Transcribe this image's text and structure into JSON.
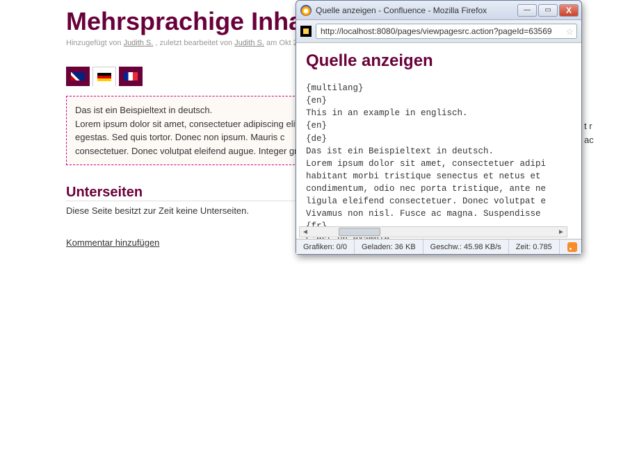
{
  "page": {
    "title": "Mehrsprachige Inha",
    "meta_prefix": "Hinzugefügt von ",
    "author": "Judith S.",
    "meta_mid": ", zuletzt bearbeitet von ",
    "editor": "Judith S.",
    "meta_date": " am Okt 20, 2",
    "content_line1": "Das ist ein Beispieltext in deutsch.",
    "content_line2": "Lorem ipsum dolor sit amet, consectetuer adipiscing elit,",
    "content_line3": "egestas. Sed quis tortor. Donec non ipsum. Mauris c",
    "content_line4": "consectetuer. Donec volutpat eleifend augue. Integer gravi",
    "subsection_title": "Unterseiten",
    "subsection_text": "Diese Seite besitzt zur Zeit keine Unterseiten.",
    "add_comment": "Kommentar hinzufügen",
    "side_hint1": "t r",
    "side_hint2": "ac"
  },
  "popup": {
    "window_title": "Quelle anzeigen - Confluence - Mozilla Firefox",
    "url": "http://localhost:8080/pages/viewpagesrc.action?pageId=63569",
    "heading": "Quelle anzeigen",
    "source": "{multilang}\n{en}\nThis in an example in englisch.\n{en}\n{de}\nDas ist ein Beispieltext in deutsch.\nLorem ipsum dolor sit amet, consectetuer adipi\nhabitant morbi tristique senectus et netus et \ncondimentum, odio nec porta tristique, ante ne\nligula eleifend consectetuer. Donec volutpat e\nVivamus non nisl. Fusce ac magna. Suspendisse \n{fr}\nC'est un example.",
    "status": {
      "grafiken": "Grafiken: 0/0",
      "geladen": "Geladen: 36 KB",
      "geschw": "Geschw.: 45.98 KB/s",
      "zeit": "Zeit: 0.785"
    }
  }
}
